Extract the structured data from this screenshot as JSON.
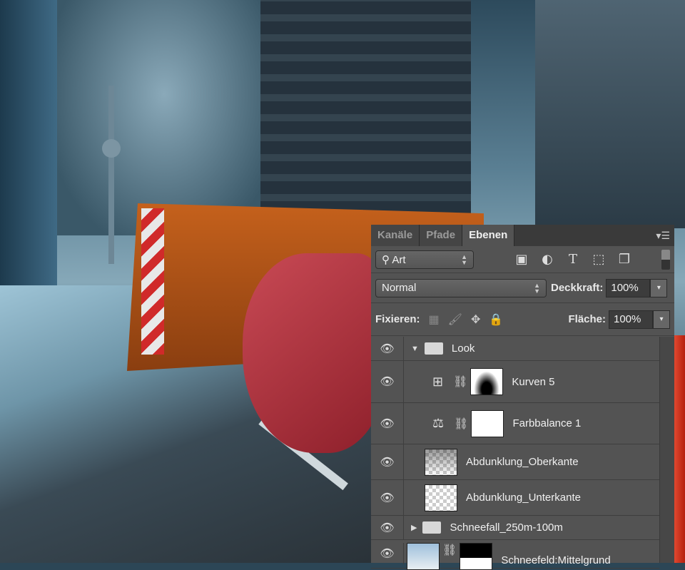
{
  "panel": {
    "tabs": [
      {
        "label": "Kanäle"
      },
      {
        "label": "Pfade"
      },
      {
        "label": "Ebenen",
        "active": true
      }
    ],
    "filter": {
      "label": "Art",
      "icons": [
        "image-filter-icon",
        "adjustment-filter-icon",
        "type-filter-icon",
        "shape-filter-icon",
        "smart-object-filter-icon"
      ]
    },
    "blend_mode": "Normal",
    "opacity_label": "Deckkraft:",
    "opacity_value": "100%",
    "lock_label": "Fixieren:",
    "fill_label": "Fläche:",
    "fill_value": "100%",
    "layers": [
      {
        "name": "Look",
        "type": "group",
        "expanded": true
      },
      {
        "name": "Kurven 5",
        "type": "curves-adjustment"
      },
      {
        "name": "Farbbalance 1",
        "type": "color-balance-adjustment"
      },
      {
        "name": "Abdunklung_Oberkante",
        "type": "pixel"
      },
      {
        "name": "Abdunklung_Unterkante",
        "type": "pixel"
      },
      {
        "name": "Schneefall_250m-100m",
        "type": "group",
        "expanded": false
      },
      {
        "name": "Schneefeld:Mittelgrund",
        "type": "pixel-with-mask"
      }
    ]
  }
}
